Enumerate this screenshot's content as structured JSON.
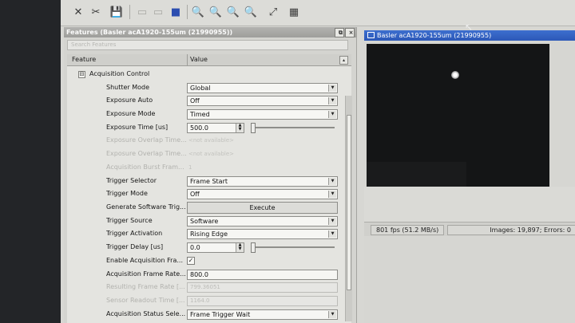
{
  "features_panel": {
    "title": "Features (Basler acA1920-155um (21990955))",
    "title_buttons": [
      "⧉",
      "×"
    ],
    "search_placeholder": "Search Features",
    "col_feature": "Feature",
    "col_value": "Value",
    "sort_glyph": "▴",
    "category": {
      "expander": "⊟",
      "label": "Acquisition Control"
    },
    "rows": [
      {
        "label": "Shutter Mode",
        "value": "Global"
      },
      {
        "label": "Exposure Auto",
        "value": "Off"
      },
      {
        "label": "Exposure Mode",
        "value": "Timed"
      },
      {
        "label": "Exposure Time [us]",
        "value": "500.0"
      },
      {
        "label": "Exposure Overlap Time...",
        "value": "<not available>"
      },
      {
        "label": "Exposure Overlap Time...",
        "value": "<not available>"
      },
      {
        "label": "Acquisition Burst Fram...",
        "value": "1"
      },
      {
        "label": "Trigger Selector",
        "value": "Frame Start"
      },
      {
        "label": "Trigger Mode",
        "value": "Off"
      },
      {
        "label": "Generate Software Trig...",
        "value": "Execute"
      },
      {
        "label": "Trigger Source",
        "value": "Software"
      },
      {
        "label": "Trigger Activation",
        "value": "Rising Edge"
      },
      {
        "label": "Trigger Delay [us]",
        "value": "0.0"
      },
      {
        "label": "Enable Acquisition Fra...",
        "value": "✓"
      },
      {
        "label": "Acquisition Frame Rate...",
        "value": "800.0"
      },
      {
        "label": "Resulting Frame Rate [...",
        "value": "799.36051"
      },
      {
        "label": "Sensor Readout Time [...",
        "value": "1164.0"
      },
      {
        "label": "Acquisition Status Sele...",
        "value": "Frame Trigger Wait"
      }
    ]
  },
  "camera_panel": {
    "title": "Basler acA1920-155um (21990955)",
    "fps": "801 fps (51.2 MB/s)",
    "images": "Images: 19,897; Errors: 0"
  },
  "toolbar": {
    "icons": [
      "✕",
      "✂",
      "💾",
      "▭",
      "▭",
      "■",
      "🔍",
      "🔍",
      "🔍",
      "🔍",
      "⤢",
      "▦"
    ]
  }
}
